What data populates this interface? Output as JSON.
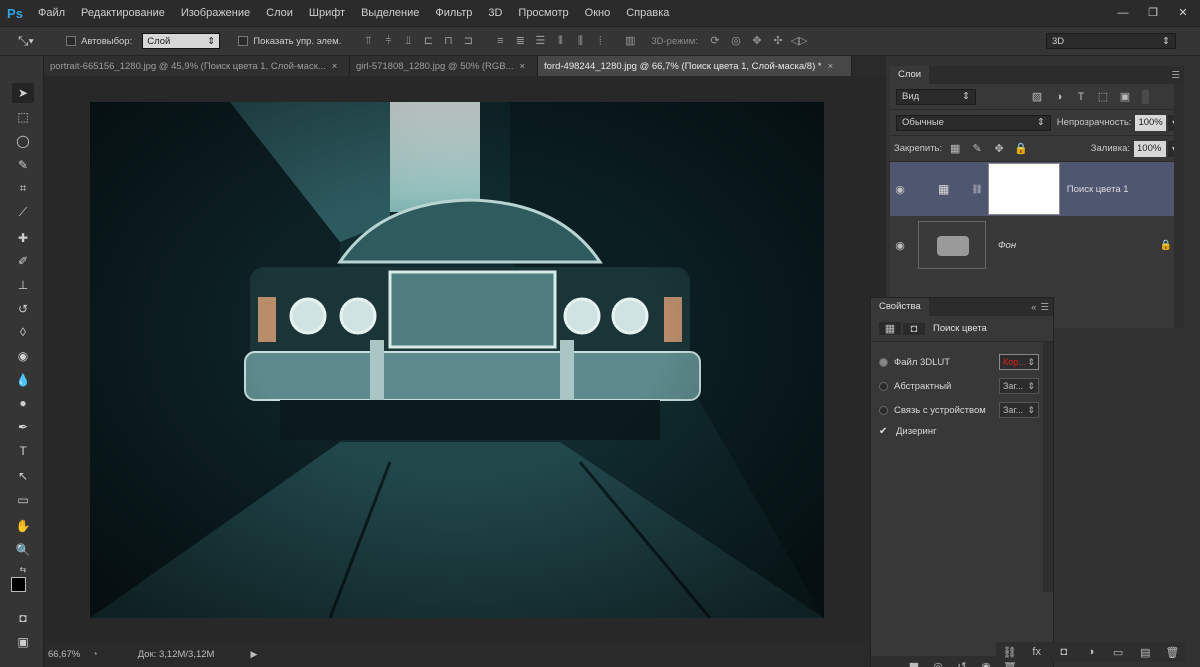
{
  "app": {
    "logo": "Ps",
    "accent": "#2fa3e8"
  },
  "menu": [
    "Файл",
    "Редактирование",
    "Изображение",
    "Слои",
    "Шрифт",
    "Выделение",
    "Фильтр",
    "3D",
    "Просмотр",
    "Окно",
    "Справка"
  ],
  "window_controls": [
    "minimize-icon",
    "restore-icon",
    "close-icon"
  ],
  "options": {
    "autoselect_label": "Автовыбор:",
    "autoselect_value": "Слой",
    "show_controls_label": "Показать упр. элем.",
    "mode3d_label": "3D-режим:",
    "workspace_value": "3D"
  },
  "tabs": [
    {
      "label": "portrait-665156_1280.jpg @ 45,9% (Поиск цвета 1, Слой-маск...",
      "close": "×"
    },
    {
      "label": "girl-571808_1280.jpg @ 50% (RGB...",
      "close": "×"
    },
    {
      "label": "ford-498244_1280.jpg @ 66,7% (Поиск цвета 1, Слой-маска/8) *",
      "close": "×"
    }
  ],
  "status": {
    "zoom": "66,67%",
    "doc": "Док: 3,12M/3,12M"
  },
  "layers_panel": {
    "title": "Слои",
    "filter": "Вид",
    "blend": "Обычные",
    "opacity_label": "Непрозрачность:",
    "opacity": "100%",
    "lock_label": "Закрепить:",
    "fill_label": "Заливка:",
    "fill": "100%",
    "layers": [
      {
        "name": "Поиск цвета 1"
      },
      {
        "name": "Фон"
      }
    ]
  },
  "properties_panel": {
    "title": "Свойства",
    "subtitle": "Поиск цвета",
    "options": [
      {
        "label": "Файл 3DLUT",
        "value": "Кор..."
      },
      {
        "label": "Абстрактный",
        "value": "Заг..."
      },
      {
        "label": "Связь с устройством",
        "value": "Заг..."
      }
    ],
    "dither_label": "Дизеринг"
  }
}
